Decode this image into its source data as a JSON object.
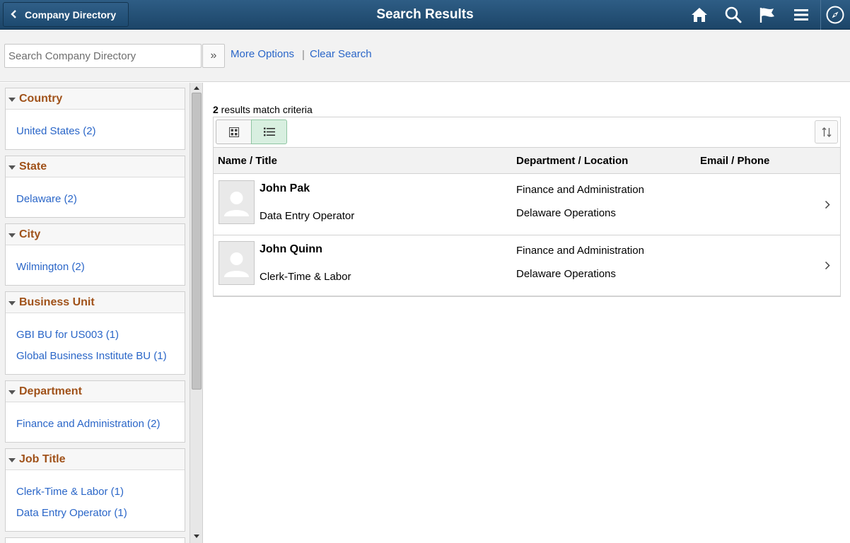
{
  "header": {
    "back_label": "Company Directory",
    "title": "Search Results",
    "icons": [
      "home-icon",
      "search-icon",
      "flag-icon",
      "menu-icon",
      "navigator-icon"
    ],
    "bg_color": "#1f4a6e"
  },
  "search": {
    "placeholder": "Search Company Directory",
    "value": "",
    "go_label": "»",
    "more_options": "More Options",
    "separator": "|",
    "clear_search": "Clear Search"
  },
  "facets": [
    {
      "title": "Country",
      "items": [
        "United States (2)"
      ]
    },
    {
      "title": "State",
      "items": [
        "Delaware (2)"
      ]
    },
    {
      "title": "City",
      "items": [
        "Wilmington (2)"
      ]
    },
    {
      "title": "Business Unit",
      "items": [
        "GBI BU for US003 (1)",
        "Global Business Institute BU (1)"
      ]
    },
    {
      "title": "Department",
      "items": [
        "Finance and Administration (2)"
      ]
    },
    {
      "title": "Job Title",
      "items": [
        "Clerk-Time & Labor (1)",
        "Data Entry Operator (1)"
      ]
    }
  ],
  "results": {
    "count": "2",
    "count_suffix": " results match criteria",
    "columns": [
      "Name / Title",
      "Department / Location",
      "Email / Phone"
    ],
    "rows": [
      {
        "name": "John Pak",
        "title": "Data Entry Operator",
        "department": "Finance and Administration",
        "location": "Delaware Operations"
      },
      {
        "name": "John Quinn",
        "title": "Clerk-Time & Labor",
        "department": "Finance and Administration",
        "location": "Delaware Operations"
      }
    ]
  },
  "colors": {
    "link": "#2a66c8",
    "facet_title": "#a0521a",
    "active_view": "#d8efe0"
  }
}
